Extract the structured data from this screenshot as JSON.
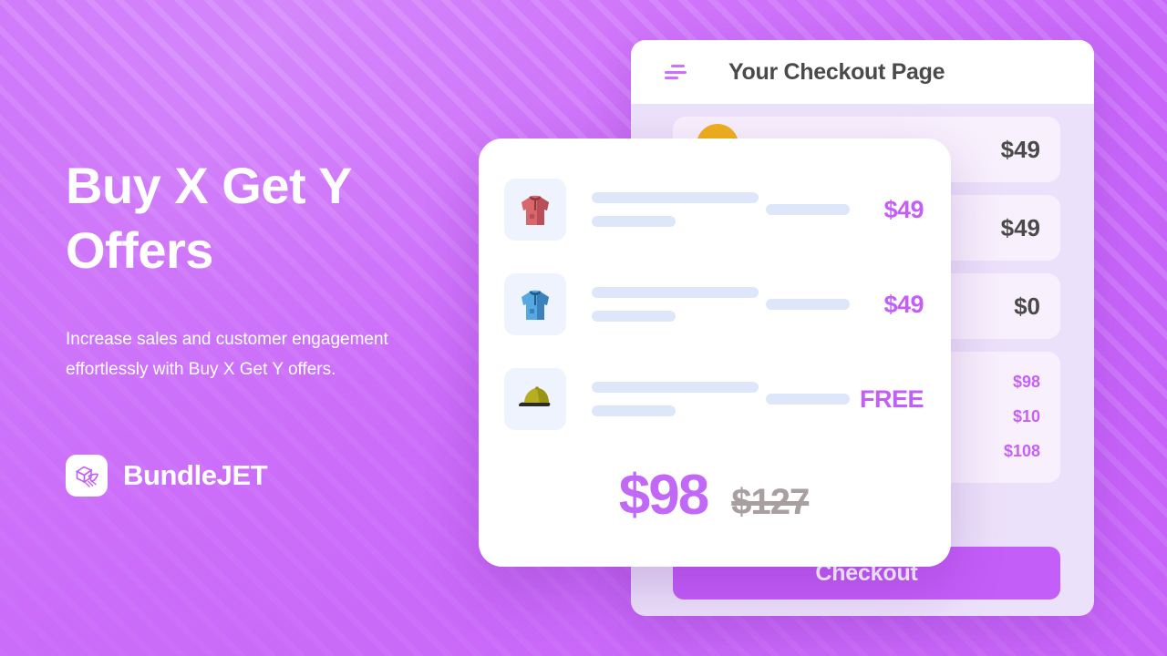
{
  "hero": {
    "headline": "Buy X Get Y Offers",
    "subtext": "Increase sales and customer engagement effortlessly with Buy X Get Y offers.",
    "brand_name": "BundleJET",
    "brand_logo_icon": "bundle-box-rocket-icon"
  },
  "colors": {
    "brand_purple": "#c45ef8",
    "accent_price": "#c168f6",
    "bg_gradient_start": "#d486fb",
    "bg_gradient_end": "#c45ef8",
    "panel_bg": "#ece1fa",
    "row_bg": "#f8f0fd",
    "skeleton_blue": "#dee7fa",
    "skeleton_gray": "#d8d2de",
    "text_dark": "#4a4a4a"
  },
  "checkout_panel": {
    "title": "Your Checkout Page",
    "menu_icon": "hamburger-menu-icon",
    "rows": [
      {
        "amount": "$49"
      },
      {
        "amount": "$49"
      },
      {
        "amount": "$0"
      }
    ],
    "summary": [
      {
        "amount": "$98"
      },
      {
        "amount": "$10"
      },
      {
        "amount": "$108"
      }
    ],
    "checkout_button": "Checkout"
  },
  "offer_card": {
    "items": [
      {
        "thumbnail_icon": "red-hoodie-icon",
        "price": "$49"
      },
      {
        "thumbnail_icon": "blue-hoodie-icon",
        "price": "$49"
      },
      {
        "thumbnail_icon": "olive-cap-icon",
        "price": "FREE"
      }
    ],
    "total_new": "$98",
    "total_old": "$127"
  }
}
